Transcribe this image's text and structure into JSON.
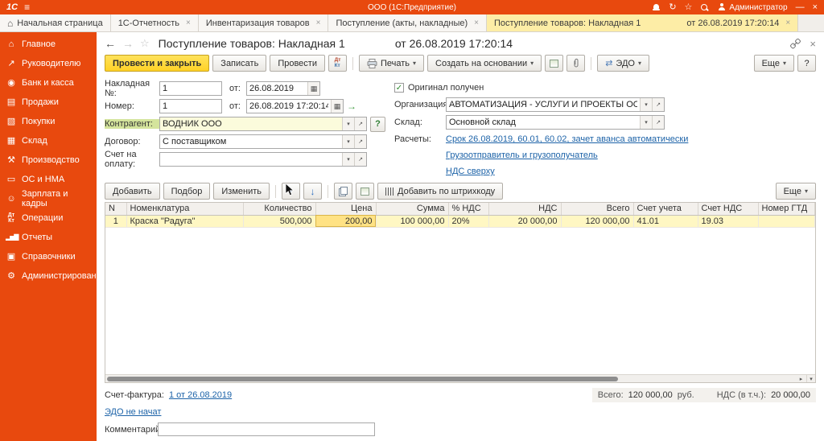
{
  "colors": {
    "accent": "#e8490e",
    "active_tab": "#fdeda6",
    "link": "#1d63a8",
    "row_highlight": "#fff7c3",
    "selected_cell": "#ffe284",
    "primary_button": "#ffd226"
  },
  "icons": {
    "menu": "≡",
    "history": "↻",
    "favorites": "☆",
    "minimize": "—",
    "close": "×",
    "home": "⌂",
    "back": "←",
    "forward": "→",
    "form_star": "☆",
    "form_close": "×",
    "dropdown": "▾",
    "open": "↗",
    "calendar": "▦",
    "set_date": "→",
    "check": "✓",
    "up": "↑",
    "down": "↓",
    "tab_close": "×",
    "scroll_right": "▸",
    "scroll_down": "▾",
    "edo": "⇄"
  },
  "topbar": {
    "logo": "1С",
    "title": "ООО (1С:Предприятие)",
    "user": "Администратор"
  },
  "tabs": {
    "home": {
      "label": "Начальная страница"
    },
    "items": [
      {
        "label": "1С-Отчетность"
      },
      {
        "label": "Инвентаризация товаров"
      },
      {
        "label": "Поступление (акты, накладные)"
      },
      {
        "label": "Поступление товаров: Накладная 1",
        "date": "от 26.08.2019 17:20:14"
      }
    ]
  },
  "sidebar": {
    "items": [
      {
        "label": "Главное",
        "icon": "⌂"
      },
      {
        "label": "Руководителю",
        "icon": "↗"
      },
      {
        "label": "Банк и касса",
        "icon": "◉"
      },
      {
        "label": "Продажи",
        "icon": "▤"
      },
      {
        "label": "Покупки",
        "icon": "▧"
      },
      {
        "label": "Склад",
        "icon": "▦"
      },
      {
        "label": "Производство",
        "icon": "⚒"
      },
      {
        "label": "ОС и НМА",
        "icon": "▭"
      },
      {
        "label": "Зарплата и кадры",
        "icon": "☺"
      },
      {
        "label": "Операции",
        "icon": "Дт Кт"
      },
      {
        "label": "Отчеты",
        "icon": "▂▅▇"
      },
      {
        "label": "Справочники",
        "icon": "▣"
      },
      {
        "label": "Администрирование",
        "icon": "⚙"
      }
    ]
  },
  "form": {
    "title": "Поступление товаров: Накладная 1",
    "title_date": "от 26.08.2019 17:20:14",
    "toolbar": {
      "post_close": "Провести и закрыть",
      "write": "Записать",
      "post": "Провести",
      "dt": "Дт",
      "kt": "Кт",
      "print": "Печать",
      "create_based": "Создать на основании",
      "edo": "ЭДО",
      "more": "Еще",
      "help": "?"
    },
    "fields": {
      "invoice_label": "Накладная №:",
      "invoice_no": "1",
      "from_label": "от:",
      "invoice_date": "26.08.2019",
      "number_label": "Номер:",
      "number": "1",
      "number_date": "26.08.2019 17:20:14",
      "counterparty_label": "Контрагент:",
      "counterparty": "ВОДНИК ООО",
      "counterparty_help": "?",
      "contract_label": "Договор:",
      "contract": "С поставщиком",
      "payment_invoice_label": "Счет на оплату:",
      "payment_invoice": "",
      "original_received": "Оригинал получен",
      "organization_label": "Организация:",
      "organization": "АВТОМАТИЗАЦИЯ - УСЛУГИ И ПРОЕКТЫ ООО",
      "warehouse_label": "Склад:",
      "warehouse": "Основной склад",
      "settlements_label": "Расчеты:",
      "settlements_link": "Срок 26.08.2019, 60.01, 60.02, зачет аванса автоматически",
      "shipper_link": "Грузоотправитель и грузополучатель",
      "vat_link": "НДС сверху"
    },
    "items_toolbar": {
      "add": "Добавить",
      "pick": "Подбор",
      "edit": "Изменить",
      "add_barcode": "Добавить по штрихкоду",
      "more": "Еще"
    },
    "table": {
      "columns": [
        "N",
        "Номенклатура",
        "Количество",
        "Цена",
        "Сумма",
        "% НДС",
        "НДС",
        "Всего",
        "Счет учета",
        "Счет НДС",
        "Номер ГТД"
      ],
      "rows": [
        [
          "1",
          "Краска \"Радуга\"",
          "500,000",
          "200,00",
          "100 000,00",
          "20%",
          "20 000,00",
          "120 000,00",
          "41.01",
          "19.03",
          ""
        ]
      ]
    },
    "footer": {
      "invoice_label": "Счет-фактура:",
      "invoice_link": "1 от 26.08.2019",
      "total_label": "Всего:",
      "total": "120 000,00",
      "currency": "руб.",
      "vat_label": "НДС (в т.ч.):",
      "vat": "20 000,00",
      "edo_status": "ЭДО не начат",
      "comment_label": "Комментарий:",
      "comment": ""
    }
  }
}
